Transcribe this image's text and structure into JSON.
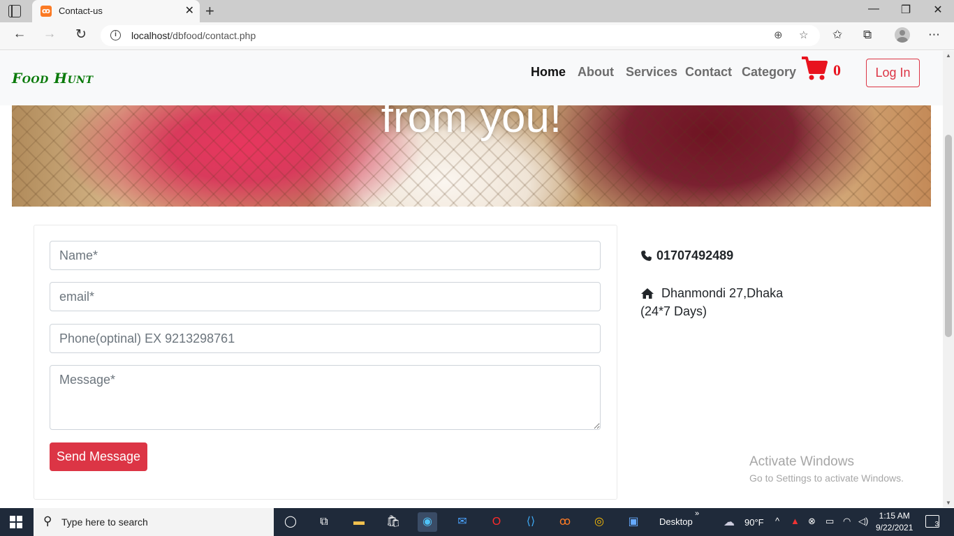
{
  "browser": {
    "tab_title": "Contact-us",
    "url_host": "localhost",
    "url_path": "/dbfood/contact.php",
    "close_tab_glyph": "✕",
    "new_tab_glyph": "+"
  },
  "site": {
    "brand": "Food Hunt",
    "nav": {
      "home": "Home",
      "about": "About",
      "services": "Services",
      "contact": "Contact",
      "category": "Category"
    },
    "cart_count": "0",
    "login_label": "Log In",
    "accent_color": "#dc3545",
    "brand_color": "#0a7a0a"
  },
  "hero": {
    "text": "from you!"
  },
  "form": {
    "name_placeholder": "Name*",
    "email_placeholder": "email*",
    "phone_placeholder": "Phone(optinal) EX 9213298761",
    "message_placeholder": "Message*",
    "send_label": "Send Message"
  },
  "contact": {
    "phone": "01707492489",
    "address": "Dhanmondi 27,Dhaka",
    "hours": "(24*7 Days)"
  },
  "watermark": {
    "title": "Activate Windows",
    "subtitle": "Go to Settings to activate Windows."
  },
  "taskbar": {
    "search_placeholder": "Type here to search",
    "desktop_label": "Desktop",
    "weather": "90°F",
    "time": "1:15 AM",
    "date": "9/22/2021",
    "notification_count": "3"
  }
}
